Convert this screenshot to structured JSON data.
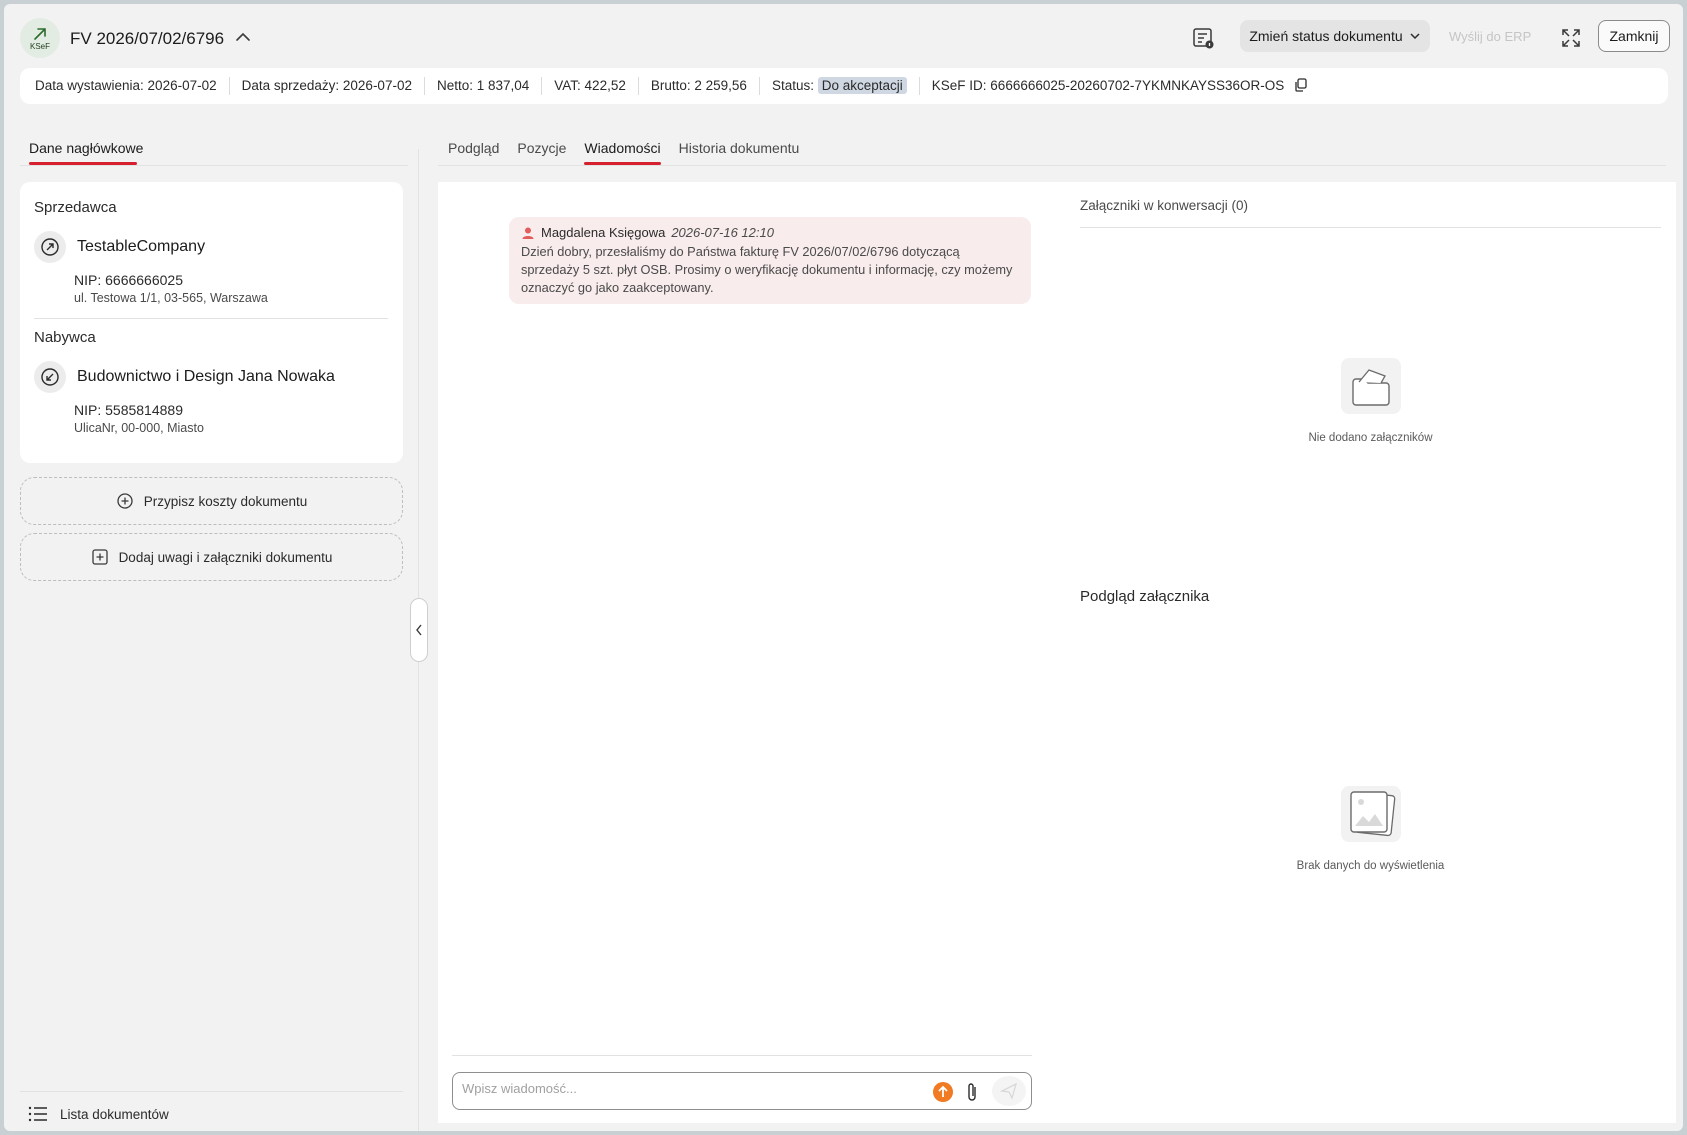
{
  "header": {
    "logo_text": "KSeF",
    "doc_number": "FV 2026/07/02/6796",
    "status_button": "Zmień status dokumentu",
    "erp_button": "Wyślij do ERP",
    "close_button": "Zamknij"
  },
  "info_bar": {
    "issue_date": "Data wystawienia: 2026-07-02",
    "sale_date": "Data sprzedaży: 2026-07-02",
    "net": "Netto: 1 837,04",
    "vat": "VAT: 422,52",
    "gross": "Brutto: 2 259,56",
    "status_label": "Status:",
    "status_value": "Do akceptacji",
    "ksef_id": "KSeF ID: 6666666025-20260702-7YKMNKAYSS36OR-OS"
  },
  "left": {
    "tab": "Dane nagłówkowe",
    "seller": {
      "title": "Sprzedawca",
      "name": "TestableCompany",
      "nip": "NIP: 6666666025",
      "address": "ul. Testowa 1/1, 03-565, Warszawa"
    },
    "buyer": {
      "title": "Nabywca",
      "name": "Budownictwo i Design Jana Nowaka",
      "nip": "NIP: 5585814889",
      "address": "UlicaNr, 00-000, Miasto"
    },
    "assign_costs": "Przypisz koszty dokumentu",
    "add_notes": "Dodaj uwagi i załączniki dokumentu",
    "doc_list": "Lista dokumentów"
  },
  "tabs": [
    "Podgląd",
    "Pozycje",
    "Wiadomości",
    "Historia dokumentu"
  ],
  "active_tab": "Wiadomości",
  "messages": [
    {
      "author": "Magdalena Księgowa",
      "time": "2026-07-16 12:10",
      "text": "Dzień dobry, przesłaliśmy do Państwa fakturę FV 2026/07/02/6796 dotyczącą sprzedaży 5 szt. płyt OSB. Prosimy o weryfikację dokumentu i informację, czy możemy oznaczyć go jako zaakceptowany."
    }
  ],
  "composer": {
    "placeholder": "Wpisz wiadomość..."
  },
  "attachments": {
    "title": "Załączniki w konwersacji (0)",
    "empty_text": "Nie dodano załączników",
    "preview_title": "Podgląd załącznika",
    "preview_empty": "Brak danych do wyświetlenia"
  },
  "colors": {
    "accent_red": "#d6202f",
    "message_bg": "#f8ecec",
    "status_badge_bg": "#cfd8e2",
    "upload_orange": "#f07b22"
  }
}
